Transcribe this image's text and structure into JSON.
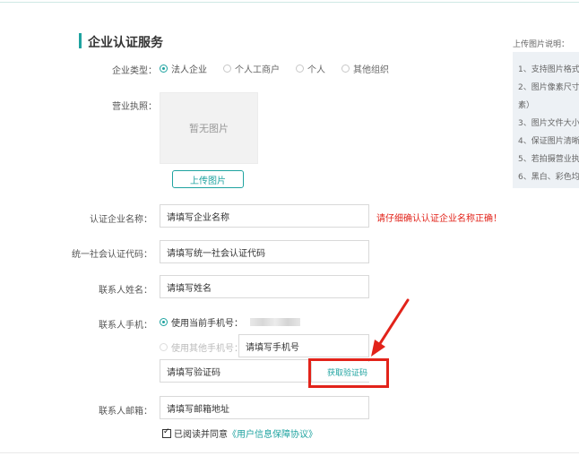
{
  "title": "企业认证服务",
  "enterprise_type": {
    "label": "企业类型：",
    "options": [
      {
        "label": "法人企业",
        "selected": true
      },
      {
        "label": "个人工商户",
        "selected": false
      },
      {
        "label": "个人",
        "selected": false
      },
      {
        "label": "其他组织",
        "selected": false
      }
    ]
  },
  "license": {
    "label": "营业执照：",
    "empty_text": "暂无图片",
    "upload_label": "上传图片"
  },
  "company_name": {
    "label": "认证企业名称：",
    "placeholder": "请填写企业名称",
    "warning": "请仔细确认认证企业名称正确！"
  },
  "credit_code": {
    "label": "统一社会认证代码：",
    "placeholder": "请填写统一社会认证代码"
  },
  "contact_name": {
    "label": "联系人姓名：",
    "placeholder": "请填写姓名"
  },
  "contact_phone": {
    "label": "联系人手机：",
    "use_current": "使用当前手机号：",
    "use_other": "使用其他手机号：",
    "other_placeholder": "请填写手机号",
    "code_placeholder": "请填写验证码",
    "get_code": "获取验证码"
  },
  "contact_email": {
    "label": "联系人邮箱：",
    "placeholder": "请填写邮箱地址"
  },
  "agreement": {
    "prefix": "已阅读并同意",
    "link": "《用户信息保障协议》",
    "checked": true
  },
  "side_notes": {
    "title": "上传图片说明：",
    "items": [
      "1、支持图片格式：",
      "2、图片像素尺寸：",
      "素）",
      "3、图片文件大小：",
      "4、保证图片清晰，",
      "5、若拍摄营业执照",
      "6、黑白、彩色均可"
    ]
  },
  "colors": {
    "accent": "#1fa3a0",
    "warning": "#e2231a",
    "highlight": "#e2231a"
  }
}
